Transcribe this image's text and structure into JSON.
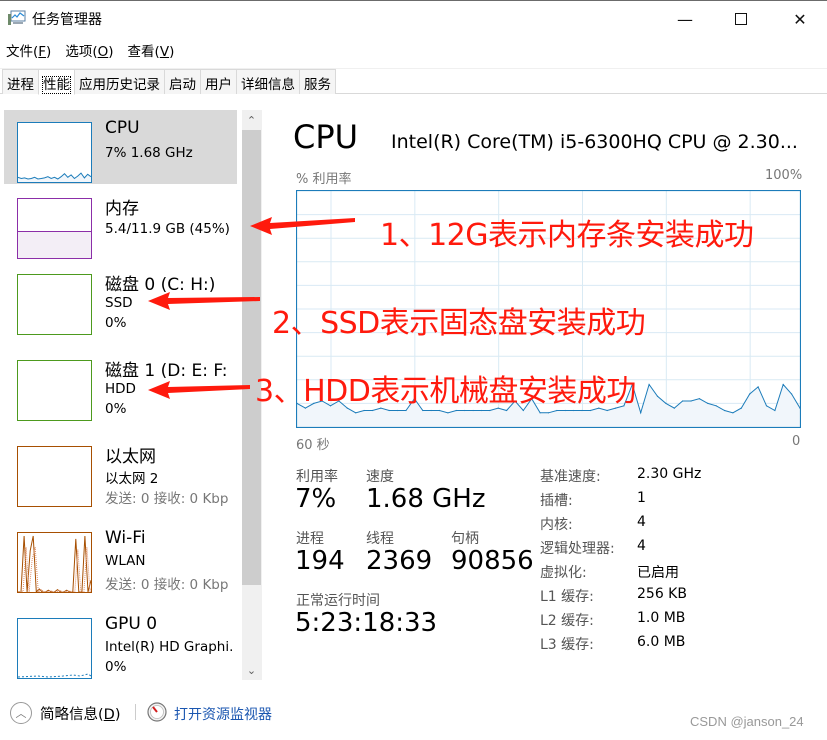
{
  "window": {
    "title": "任务管理器",
    "controls": {
      "minimize": "—",
      "maximize": "☐",
      "close": "✕"
    }
  },
  "menu": [
    {
      "label": "文件(",
      "key": "F",
      "tail": ")"
    },
    {
      "label": "选项(",
      "key": "O",
      "tail": ")"
    },
    {
      "label": "查看(",
      "key": "V",
      "tail": ")"
    }
  ],
  "tabs": [
    {
      "label": "进程",
      "active": false
    },
    {
      "label": "性能",
      "active": true
    },
    {
      "label": "应用历史记录",
      "active": false
    },
    {
      "label": "启动",
      "active": false
    },
    {
      "label": "用户",
      "active": false
    },
    {
      "label": "详细信息",
      "active": false
    },
    {
      "label": "服务",
      "active": false
    }
  ],
  "sidebar": {
    "items": [
      {
        "title": "CPU",
        "line1": "7% 1.68 GHz",
        "line2": "",
        "color": "#1c7cba",
        "selected": true
      },
      {
        "title": "内存",
        "line1": "5.4/11.9 GB (45%)",
        "line2": "",
        "color": "#8b2ea8",
        "selected": false,
        "usage": 0.45
      },
      {
        "title": "磁盘 0 (C: H:)",
        "line1": "SSD",
        "line2": "0%",
        "color": "#4d9a1e",
        "selected": false
      },
      {
        "title": "磁盘 1 (D: E: F:",
        "line1": "HDD",
        "line2": "0%",
        "color": "#4d9a1e",
        "selected": false
      },
      {
        "title": "以太网",
        "line1": "以太网 2",
        "line2": "发送: 0 接收: 0 Kbp",
        "color": "#a74f01",
        "selected": false
      },
      {
        "title": "Wi-Fi",
        "line1": "WLAN",
        "line2": "发送: 0 接收: 0 Kbp",
        "color": "#a74f01",
        "selected": false
      },
      {
        "title": "GPU 0",
        "line1": "Intel(R) HD Graphi.",
        "line2": "0%",
        "color": "#1c7cba",
        "selected": false
      }
    ]
  },
  "main": {
    "heading": "CPU",
    "model": "Intel(R) Core(TM) i5-6300HQ CPU @ 2.30...",
    "chart_top_left": "% 利用率",
    "chart_top_right": "100%",
    "chart_bottom_left": "60 秒",
    "chart_bottom_right": "0",
    "stats": {
      "utilization_label": "利用率",
      "utilization_value": "7%",
      "speed_label": "速度",
      "speed_value": "1.68 GHz",
      "processes_label": "进程",
      "processes_value": "194",
      "threads_label": "线程",
      "threads_value": "2369",
      "handles_label": "句柄",
      "handles_value": "90856",
      "uptime_label": "正常运行时间",
      "uptime_value": "5:23:18:33"
    },
    "specs": [
      {
        "label": "基准速度:",
        "value": "2.30 GHz"
      },
      {
        "label": "插槽:",
        "value": "1"
      },
      {
        "label": "内核:",
        "value": "4"
      },
      {
        "label": "逻辑处理器:",
        "value": "4"
      },
      {
        "label": "虚拟化:",
        "value": "已启用"
      },
      {
        "label": "L1 缓存:",
        "value": "256 KB"
      },
      {
        "label": "L2 缓存:",
        "value": "1.0 MB"
      },
      {
        "label": "L3 缓存:",
        "value": "6.0 MB"
      }
    ]
  },
  "annotations": [
    "1、12G表示内存条安装成功",
    "2、SSD表示固态盘安装成功",
    "3、HDD表示机械盘安装成功"
  ],
  "footer": {
    "fewer_details": "简略信息(",
    "fewer_details_key": "D",
    "fewer_details_tail": ")",
    "open_resource_monitor": "打开资源监视器"
  },
  "watermark": "CSDN @janson_24",
  "chart_data": {
    "type": "area",
    "title": "CPU % 利用率",
    "xlabel": "60 秒 → 0",
    "ylabel": "% 利用率",
    "xlim": [
      60,
      0
    ],
    "ylim": [
      0,
      100
    ],
    "grid": true,
    "color": "#1c7cba",
    "values": [
      10,
      8,
      10,
      11,
      9,
      11,
      8,
      6,
      7,
      7,
      8,
      7,
      7,
      7,
      12,
      7,
      7,
      7,
      6,
      7,
      7,
      7,
      7,
      7,
      8,
      7,
      11,
      7,
      12,
      6,
      6,
      7,
      7,
      7,
      7,
      7,
      8,
      7,
      8,
      9,
      18,
      6,
      18,
      13,
      10,
      8,
      11,
      11,
      12,
      10,
      9,
      7,
      6,
      8,
      14,
      17,
      9,
      7,
      18,
      14,
      8
    ]
  },
  "thumbs": {
    "cpu": [
      8,
      6,
      7,
      5,
      6,
      8,
      5,
      6,
      7,
      9,
      6,
      8,
      5,
      9,
      14,
      8,
      12,
      6,
      10,
      15,
      7,
      13,
      9
    ],
    "wifi": [
      0,
      0,
      95,
      0,
      70,
      95,
      0,
      5,
      0,
      0,
      3,
      0,
      0,
      4,
      0,
      0,
      3,
      0,
      0,
      90,
      0,
      0,
      95,
      0,
      20
    ]
  }
}
